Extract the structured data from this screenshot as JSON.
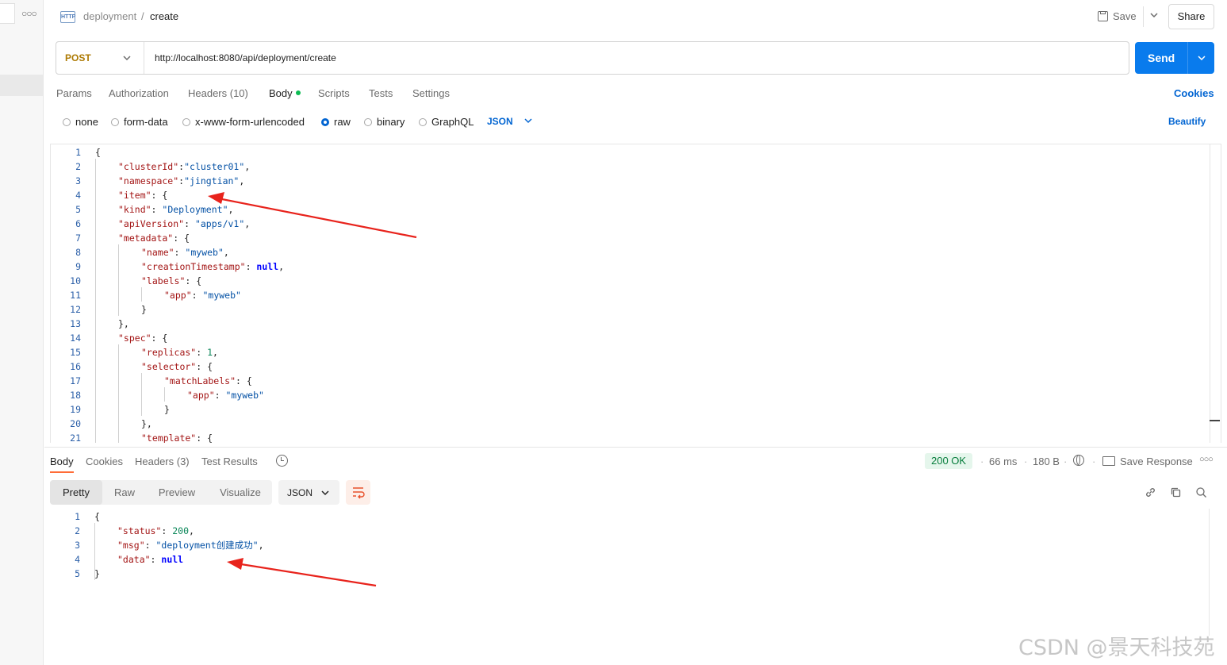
{
  "header": {
    "breadcrumb_parent": "deployment",
    "breadcrumb_sep": "/",
    "breadcrumb_current": "create",
    "save_label": "Save",
    "share_label": "Share",
    "http_icon_text": "HTTP"
  },
  "request": {
    "method": "POST",
    "url": "http://localhost:8080/api/deployment/create",
    "send_label": "Send"
  },
  "request_tabs": {
    "params": "Params",
    "authorization": "Authorization",
    "headers": "Headers (10)",
    "body": "Body",
    "scripts": "Scripts",
    "tests": "Tests",
    "settings": "Settings",
    "cookies": "Cookies"
  },
  "body_types": {
    "none": "none",
    "form_data": "form-data",
    "urlencoded": "x-www-form-urlencoded",
    "raw": "raw",
    "binary": "binary",
    "graphql": "GraphQL",
    "selected": "raw",
    "format": "JSON",
    "beautify": "Beautify"
  },
  "request_body_lines": [
    "{",
    "\"clusterId\":\"cluster01\",",
    "\"namespace\":\"jingtian\",",
    "\"item\": {",
    "\"kind\": \"Deployment\",",
    "\"apiVersion\": \"apps/v1\",",
    "\"metadata\": {",
    "\"name\": \"myweb\",",
    "\"creationTimestamp\": null,",
    "\"labels\": {",
    "\"app\": \"myweb\"",
    "}",
    "},",
    "\"spec\": {",
    "\"replicas\": 1,",
    "\"selector\": {",
    "\"matchLabels\": {",
    "\"app\": \"myweb\"",
    "}",
    "},",
    "\"template\": {"
  ],
  "response": {
    "tabs": {
      "body": "Body",
      "cookies": "Cookies",
      "headers": "Headers (3)",
      "test_results": "Test Results"
    },
    "status": "200 OK",
    "time": "66 ms",
    "size": "180 B",
    "save_response": "Save Response",
    "views": {
      "pretty": "Pretty",
      "raw": "Raw",
      "preview": "Preview",
      "visualize": "Visualize"
    },
    "format": "JSON",
    "body_lines": [
      "{",
      "\"status\": 200,",
      "\"msg\": \"deployment创建成功\",",
      "\"data\": null",
      "}"
    ]
  },
  "watermark": "CSDN @景天科技苑",
  "colors": {
    "accent_blue": "#097bed",
    "method_color": "#ad7a03",
    "status_green": "#077d3c",
    "annotation_arrow": "#e8231c"
  }
}
